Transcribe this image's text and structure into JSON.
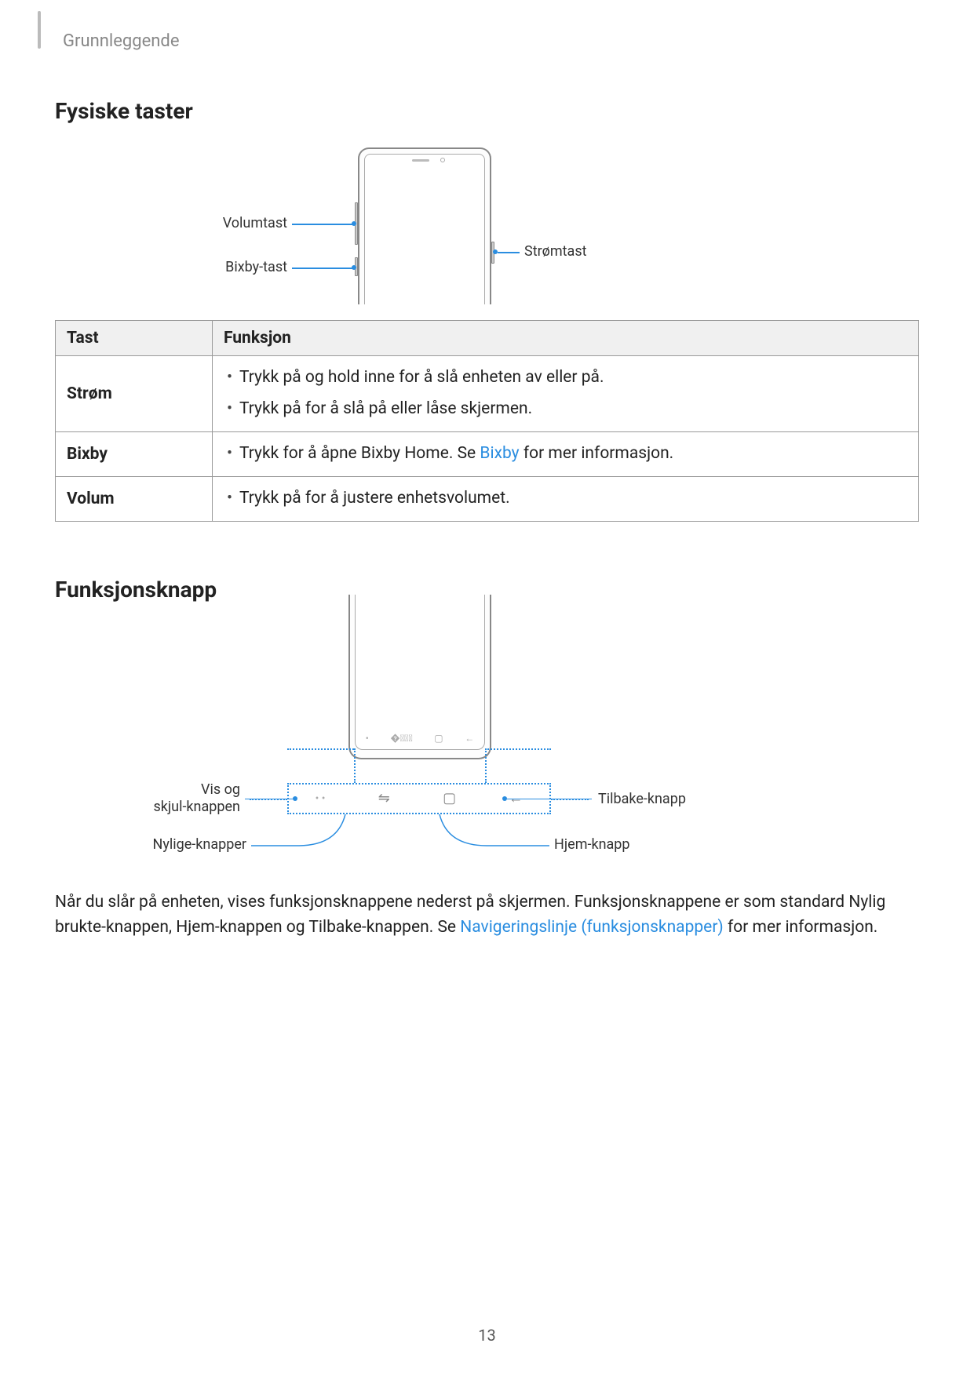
{
  "breadcrumb": "Grunnleggende",
  "section1_title": "Fysiske taster",
  "diagram1": {
    "volume": "Volumtast",
    "bixby": "Bixby-tast",
    "power": "Strømtast"
  },
  "table": {
    "header_key": "Tast",
    "header_func": "Funksjon",
    "rows": [
      {
        "name": "Strøm",
        "items": [
          {
            "text": "Trykk på og hold inne for å slå enheten av eller på."
          },
          {
            "text": "Trykk på for å slå på eller låse skjermen."
          }
        ]
      },
      {
        "name": "Bixby",
        "items": [
          {
            "pre": "Trykk for å åpne Bixby Home. Se ",
            "link": "Bixby",
            "post": " for mer informasjon."
          }
        ]
      },
      {
        "name": "Volum",
        "items": [
          {
            "text": "Trykk på for å justere enhetsvolumet."
          }
        ]
      }
    ]
  },
  "section2_title": "Funksjonsknapp",
  "diagram2": {
    "show_hide_l1": "Vis og",
    "show_hide_l2": "skjul-knappen",
    "recents": "Nylige-knapper",
    "back": "Tilbake-knapp",
    "home": "Hjem-knapp"
  },
  "paragraph": {
    "part1": "Når du slår på enheten, vises funksjonsknappene nederst på skjermen. Funksjonsknappene er som standard Nylig brukte-knappen, Hjem-knappen og Tilbake-knappen. Se ",
    "link": "Navigeringslinje (funksjonsknapper)",
    "part2": " for mer informasjon."
  },
  "page_number": "13"
}
